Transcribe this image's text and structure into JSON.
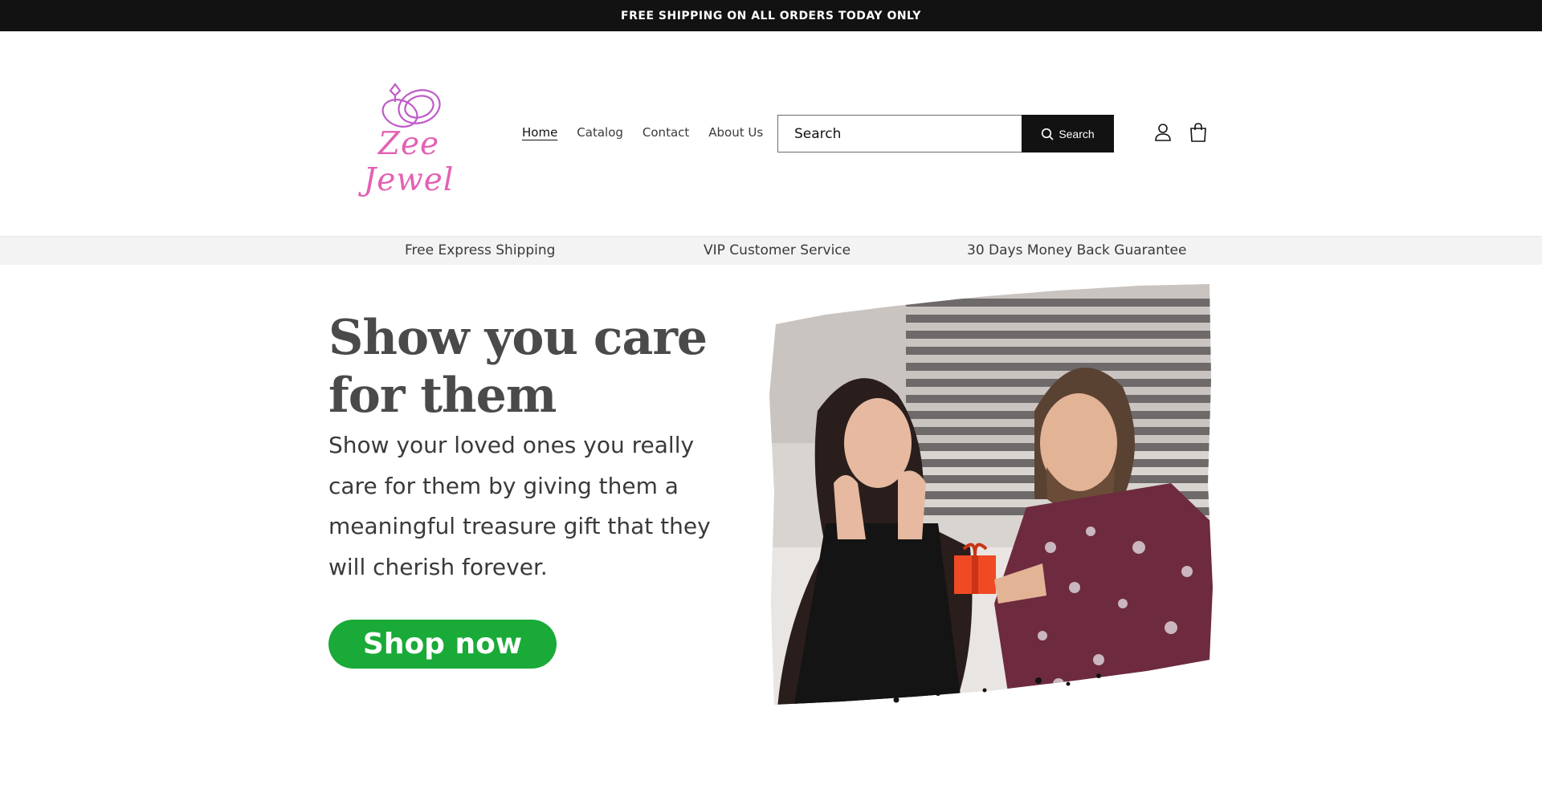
{
  "announcement": {
    "text": "FREE SHIPPING ON ALL ORDERS TODAY ONLY"
  },
  "header": {
    "logo_text": "Zee Jewel",
    "nav": [
      {
        "label": "Home",
        "active": true
      },
      {
        "label": "Catalog",
        "active": false
      },
      {
        "label": "Contact",
        "active": false
      },
      {
        "label": "About Us",
        "active": false
      }
    ],
    "search": {
      "placeholder": "Search",
      "button_label": "Search"
    },
    "icons": {
      "account": "account-icon",
      "cart": "cart-icon",
      "search": "search-icon"
    }
  },
  "usp_bar": {
    "items": [
      "Free Express Shipping",
      "VIP Customer Service",
      "30 Days Money Back Guarantee"
    ]
  },
  "hero": {
    "title": "Show you care for them",
    "text": "Show your loved ones you really care for them by giving them a meaningful treasure gift that they will cherish forever.",
    "cta_label": "Shop now",
    "image_alt": "couple-gift-photo"
  },
  "colors": {
    "announcement_bg": "#121212",
    "logo_pink": "#e460b3",
    "cta_green": "#1aaa38",
    "usp_bg": "#f3f3f3"
  }
}
